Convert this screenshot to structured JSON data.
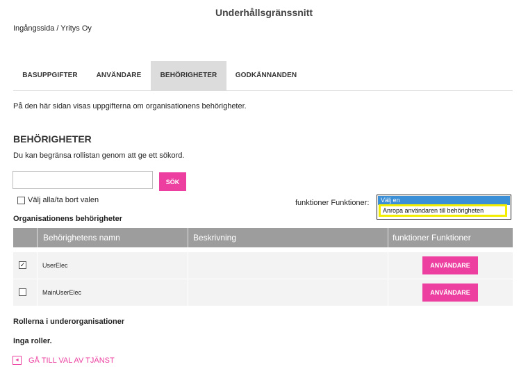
{
  "header": {
    "title": "Underhållsgränssnitt",
    "breadcrumb": "Ingångssida / Yritys Oy"
  },
  "tabs": [
    {
      "label": "BASUPPGIFTER",
      "active": false
    },
    {
      "label": "ANVÄNDARE",
      "active": false
    },
    {
      "label": "BEHÖRIGHETER",
      "active": true
    },
    {
      "label": "GODKÄNNANDEN",
      "active": false
    }
  ],
  "intro": "På den här sidan visas uppgifterna om organisationens behörigheter.",
  "section": {
    "title": "BEHÖRIGHETER",
    "description": "Du kan begränsa rollistan genom att ge ett sökord."
  },
  "search": {
    "value": "",
    "button_label": "SÖK"
  },
  "select_all": {
    "label": "Välj alla/ta bort valen",
    "checked": false
  },
  "functions": {
    "label": "funktioner Funktioner:",
    "selected_text": "Välj en",
    "option_text": "Anropa användaren till behörigheten",
    "highlight_color": "#f3ee00"
  },
  "table": {
    "caption": "Organisationens behörigheter",
    "headers": [
      "",
      "Behörighetens namn",
      "Beskrivning",
      "funktioner Funktioner"
    ],
    "rows": [
      {
        "checked": true,
        "check_mark": "✓",
        "name": "UserElec",
        "description": "",
        "action_label": "ANVÄNDARE"
      },
      {
        "checked": false,
        "check_mark": "",
        "name": "MainUserElec",
        "description": "",
        "action_label": "ANVÄNDARE"
      }
    ]
  },
  "sub_orgs": {
    "title": "Rollerna i underorganisationer",
    "empty_text": "Inga roller."
  },
  "back": {
    "icon": "◄",
    "label": "GÅ TILL VAL AV TJÄNST"
  },
  "colors": {
    "accent": "#ec3fa0",
    "header_gray": "#9d9d9d",
    "active_tab": "#dcdcdc",
    "select_blue": "#3b8fd6"
  }
}
